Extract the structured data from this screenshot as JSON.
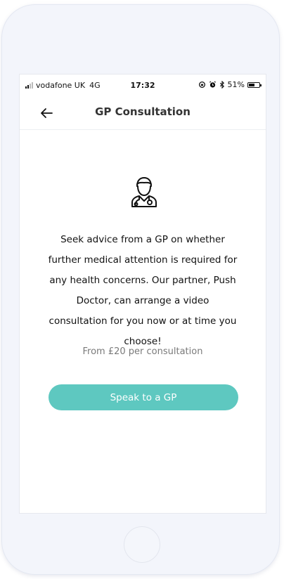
{
  "status_bar": {
    "carrier": "vodafone UK",
    "network": "4G",
    "time": "17:32",
    "battery_percent": "51%"
  },
  "nav": {
    "title": "GP Consultation",
    "back_icon": "arrow-left-icon"
  },
  "main": {
    "icon": "doctor-icon",
    "description": "Seek advice from a GP on whether further medical attention is required for any health concerns. Our partner, Push Doctor, can arrange a video consultation for you now or at time you choose!",
    "price_text": "From £20 per consultation",
    "cta_label": "Speak to a GP"
  },
  "colors": {
    "accent": "#5ec8c0",
    "text": "#111111",
    "muted": "#7a7a7a"
  }
}
